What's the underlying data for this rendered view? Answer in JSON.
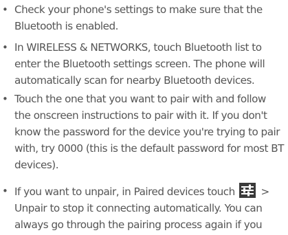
{
  "bullets": [
    {
      "lines": [
        "Check your phone's settings to make sure that the",
        "Bluetooth is enabled."
      ]
    },
    {
      "lines": [
        "In WIRELESS & NETWORKS, touch Bluetooth list to",
        "enter the Bluetooth settings screen. The phone will",
        "automatically scan for nearby Bluetooth devices."
      ]
    },
    {
      "lines": [
        "Touch the one that you want to pair with and follow",
        "the onscreen instructions to pair with it. If you don't",
        "know the password for the device you're trying to pair",
        "with, try 0000 (this is the default password for most BT",
        "devices)."
      ]
    },
    {
      "line1_before_icon": "If you want to unpair, in Paired devices touch",
      "line1_after_icon": ">",
      "icon": "settings-sliders-icon",
      "lines_after": [
        "Unpair to stop it connecting automatically. You can",
        "always go through the pairing process again if you"
      ]
    }
  ],
  "bullet_symbol": "•",
  "colors": {
    "text": "#555555",
    "icon_bg": "#3a3a3a",
    "icon_fg": "#ffffff"
  }
}
